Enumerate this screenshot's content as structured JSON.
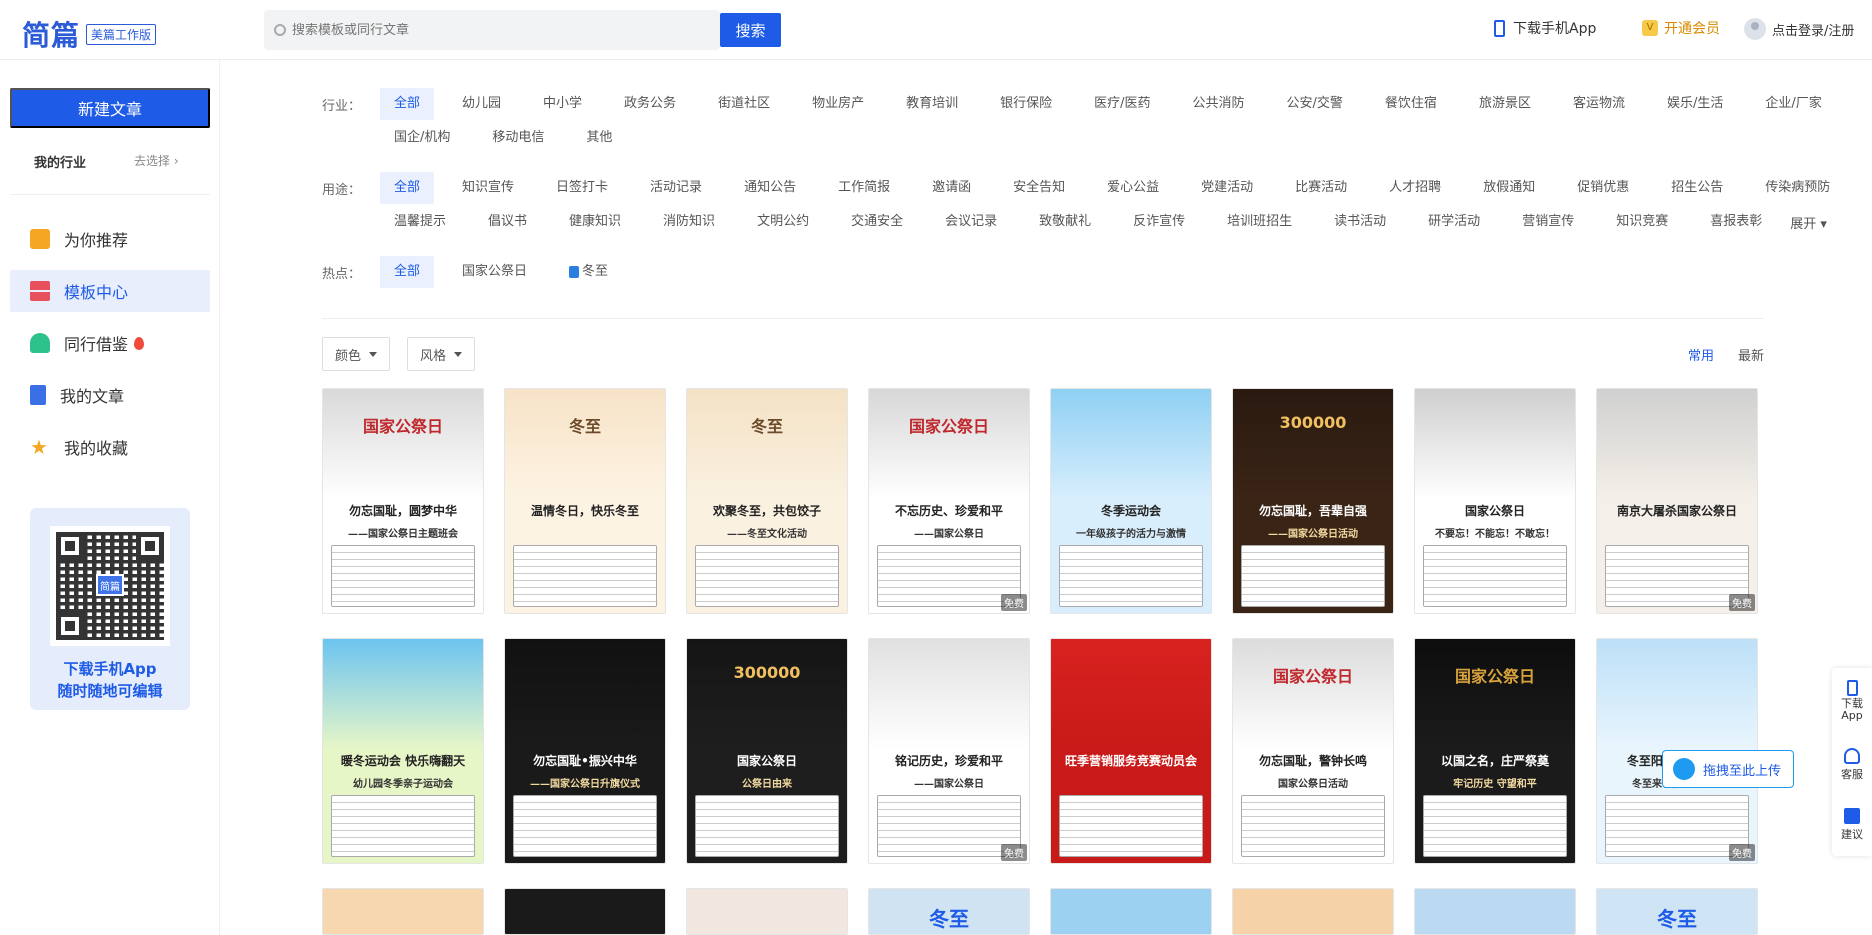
{
  "header": {
    "logo_text": "简篇",
    "logo_badge": "美篇工作版",
    "search_placeholder": "搜索模板或同行文章",
    "search_button": "搜索",
    "download_app": "下载手机App",
    "vip": "开通会员",
    "login": "点击登录/注册"
  },
  "sidebar": {
    "new_article": "新建文章",
    "my_industry": "我的行业",
    "choose": "去选择",
    "items": [
      {
        "label": "为你推荐",
        "icon": "thumbs-up-icon",
        "color": "#f5a623"
      },
      {
        "label": "模板中心",
        "icon": "template-icon",
        "color": "#e8505b"
      },
      {
        "label": "同行借鉴",
        "icon": "users-icon",
        "color": "#2ec28b"
      },
      {
        "label": "我的文章",
        "icon": "document-icon",
        "color": "#3b6fe5"
      },
      {
        "label": "我的收藏",
        "icon": "star-icon",
        "color": "#f5a623"
      }
    ],
    "qr_logo": "简篇",
    "qr_line1": "下载手机App",
    "qr_line2": "随时随地可编辑"
  },
  "filters": {
    "industry_label": "行业：",
    "industry_row1": [
      "全部",
      "幼儿园",
      "中小学",
      "政务公务",
      "街道社区",
      "物业房产",
      "教育培训",
      "银行保险",
      "医疗/医药",
      "公共消防",
      "公安/交警",
      "餐饮住宿",
      "旅游景区",
      "客运物流",
      "娱乐/生活",
      "企业/厂家"
    ],
    "industry_row2": [
      "国企/机构",
      "移动电信",
      "其他"
    ],
    "usage_label": "用途：",
    "usage_row1": [
      "全部",
      "知识宣传",
      "日签打卡",
      "活动记录",
      "通知公告",
      "工作简报",
      "邀请函",
      "安全告知",
      "爱心公益",
      "党建活动",
      "比赛活动",
      "人才招聘",
      "放假通知",
      "促销优惠",
      "招生公告",
      "传染病预防"
    ],
    "usage_row2": [
      "温馨提示",
      "倡议书",
      "健康知识",
      "消防知识",
      "文明公约",
      "交通安全",
      "会议记录",
      "致敬献礼",
      "反诈宣传",
      "培训班招生",
      "读书活动",
      "研学活动",
      "营销宣传",
      "知识竞赛",
      "喜报表彰"
    ],
    "usage_expand": "展开",
    "hot_label": "热点：",
    "hot": [
      "全部",
      "国家公祭日",
      "冬至"
    ]
  },
  "toolbar": {
    "color": "颜色",
    "style": "风格",
    "sort_common": "常用",
    "sort_newest": "最新"
  },
  "cards_row1": [
    {
      "title": "勿忘国耻，圆梦中华",
      "sub": "——国家公祭日主题班会",
      "top": "#d9d9d9",
      "bottom": "#fff",
      "art": "国家公祭日",
      "artColor": "#c0282d"
    },
    {
      "title": "温情冬日，快乐冬至",
      "sub": "",
      "top": "#f7e3c7",
      "bottom": "#fdf3e3",
      "art": "冬至",
      "artColor": "#6b4a2a"
    },
    {
      "title": "欢聚冬至，共包饺子",
      "sub": "——冬至文化活动",
      "top": "#f3e2c5",
      "bottom": "#fbf1e1",
      "art": "冬至",
      "artColor": "#6b4a2a"
    },
    {
      "title": "不忘历史、珍爱和平",
      "sub": "——国家公祭日",
      "top": "#d7d7d7",
      "bottom": "#fff",
      "art": "国家公祭日",
      "artColor": "#c0282d"
    },
    {
      "title": "冬季运动会",
      "sub": "一年级孩子的活力与激情",
      "top": "#8fd0f3",
      "bottom": "#d8eefc",
      "art": "",
      "artColor": "#1e5be6"
    },
    {
      "title": "勿忘国耻，吾辈自强",
      "sub": "——国家公祭日活动",
      "top": "#2a1a10",
      "bottom": "#3a2416",
      "art": "300000",
      "artColor": "#f0c060"
    },
    {
      "title": "国家公祭日",
      "sub": "不要忘！不能忘！不敢忘！",
      "top": "#cfcfcf",
      "bottom": "#fff",
      "art": "",
      "artColor": "#333"
    },
    {
      "title": "南京大屠杀国家公祭日",
      "sub": "",
      "top": "#d0d0d0",
      "bottom": "#f4efe8",
      "art": "",
      "artColor": "#333"
    }
  ],
  "cards_row2": [
    {
      "title": "暖冬运动会 快乐嗨翻天",
      "sub": "幼儿园冬季亲子运动会",
      "top": "#6cc4f0",
      "bottom": "#e7f6c7",
      "art": "",
      "artColor": "#1e88d4"
    },
    {
      "title": "勿忘国耻•振兴中华",
      "sub": "——国家公祭日升旗仪式",
      "top": "#111",
      "bottom": "#1a1a1a",
      "art": "",
      "artColor": "#f0c060"
    },
    {
      "title": "国家公祭日",
      "sub": "公祭日由来",
      "top": "#151515",
      "bottom": "#1e1e1e",
      "art": "300000",
      "artColor": "#f0c060"
    },
    {
      "title": "铭记历史，珍爱和平",
      "sub": "——国家公祭日",
      "top": "#e0e0e0",
      "bottom": "#fff",
      "art": "",
      "artColor": "#c0282d"
    },
    {
      "title": "旺季营销服务竞赛动员会",
      "sub": "",
      "top": "#d8221f",
      "bottom": "#c81a18",
      "art": "",
      "artColor": "#ffd24a"
    },
    {
      "title": "勿忘国耻，警钟长鸣",
      "sub": "国家公祭日活动",
      "top": "#dcdcdc",
      "bottom": "#fff",
      "art": "国家公祭日",
      "artColor": "#c0282d"
    },
    {
      "title": "以国之名，庄严祭奠",
      "sub": "牢记历史 守望和平",
      "top": "#0d0d0d",
      "bottom": "#1b1b1b",
      "art": "国家公祭日",
      "artColor": "#d8a33a"
    },
    {
      "title": "冬至阳回 情暖人间",
      "sub": "冬至来了，欢乐迎新",
      "top": "#bde0f8",
      "bottom": "#e9f5fd",
      "art": "",
      "artColor": "#1e88d4"
    }
  ],
  "cards_row3": [
    {
      "top": "#f6d7b0",
      "art": ""
    },
    {
      "top": "#1a1a1a",
      "art": ""
    },
    {
      "top": "#f1e7e0",
      "art": ""
    },
    {
      "top": "#cfe3f2",
      "art": "冬至"
    },
    {
      "top": "#9dd1f1",
      "art": ""
    },
    {
      "top": "#f5d2a8",
      "art": ""
    },
    {
      "top": "#bcd9f2",
      "art": ""
    },
    {
      "top": "#cfe4f4",
      "art": "冬至"
    }
  ],
  "badge_free": "免费",
  "float": {
    "download": "下载App",
    "service": "客服",
    "suggest": "建议",
    "upload": "拖拽至此上传"
  }
}
